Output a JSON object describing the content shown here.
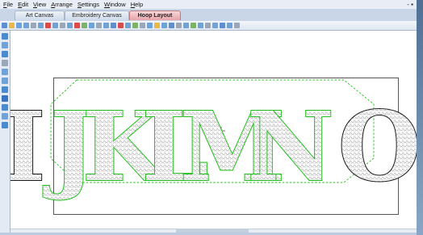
{
  "menu": [
    {
      "label": "File",
      "key": "F",
      "rest": "ile"
    },
    {
      "label": "Edit",
      "key": "E",
      "rest": "dit"
    },
    {
      "label": "View",
      "key": "V",
      "rest": "iew"
    },
    {
      "label": "Arrange",
      "key": "A",
      "rest": "rrange"
    },
    {
      "label": "Settings",
      "key": "S",
      "rest": "ettings"
    },
    {
      "label": "Window",
      "key": "W",
      "rest": "indow"
    },
    {
      "label": "Help",
      "key": "H",
      "rest": "elp"
    }
  ],
  "window_controls": "- ▪",
  "tabs": [
    {
      "label": "Art Canvas"
    },
    {
      "label": "Embroidery Canvas"
    },
    {
      "label": "Hoop Layout",
      "active": true
    }
  ],
  "design_letters": [
    "I",
    "J",
    "K",
    "L",
    "M",
    "N",
    "O"
  ],
  "colors": {
    "selected_outline": "#22c01c",
    "unselected_outline": "#1a1a1a",
    "fill_pattern": "#9a9a9a",
    "active_tab": "#e8a4a9"
  },
  "icons": {
    "cursor": "crosshair-icon"
  }
}
